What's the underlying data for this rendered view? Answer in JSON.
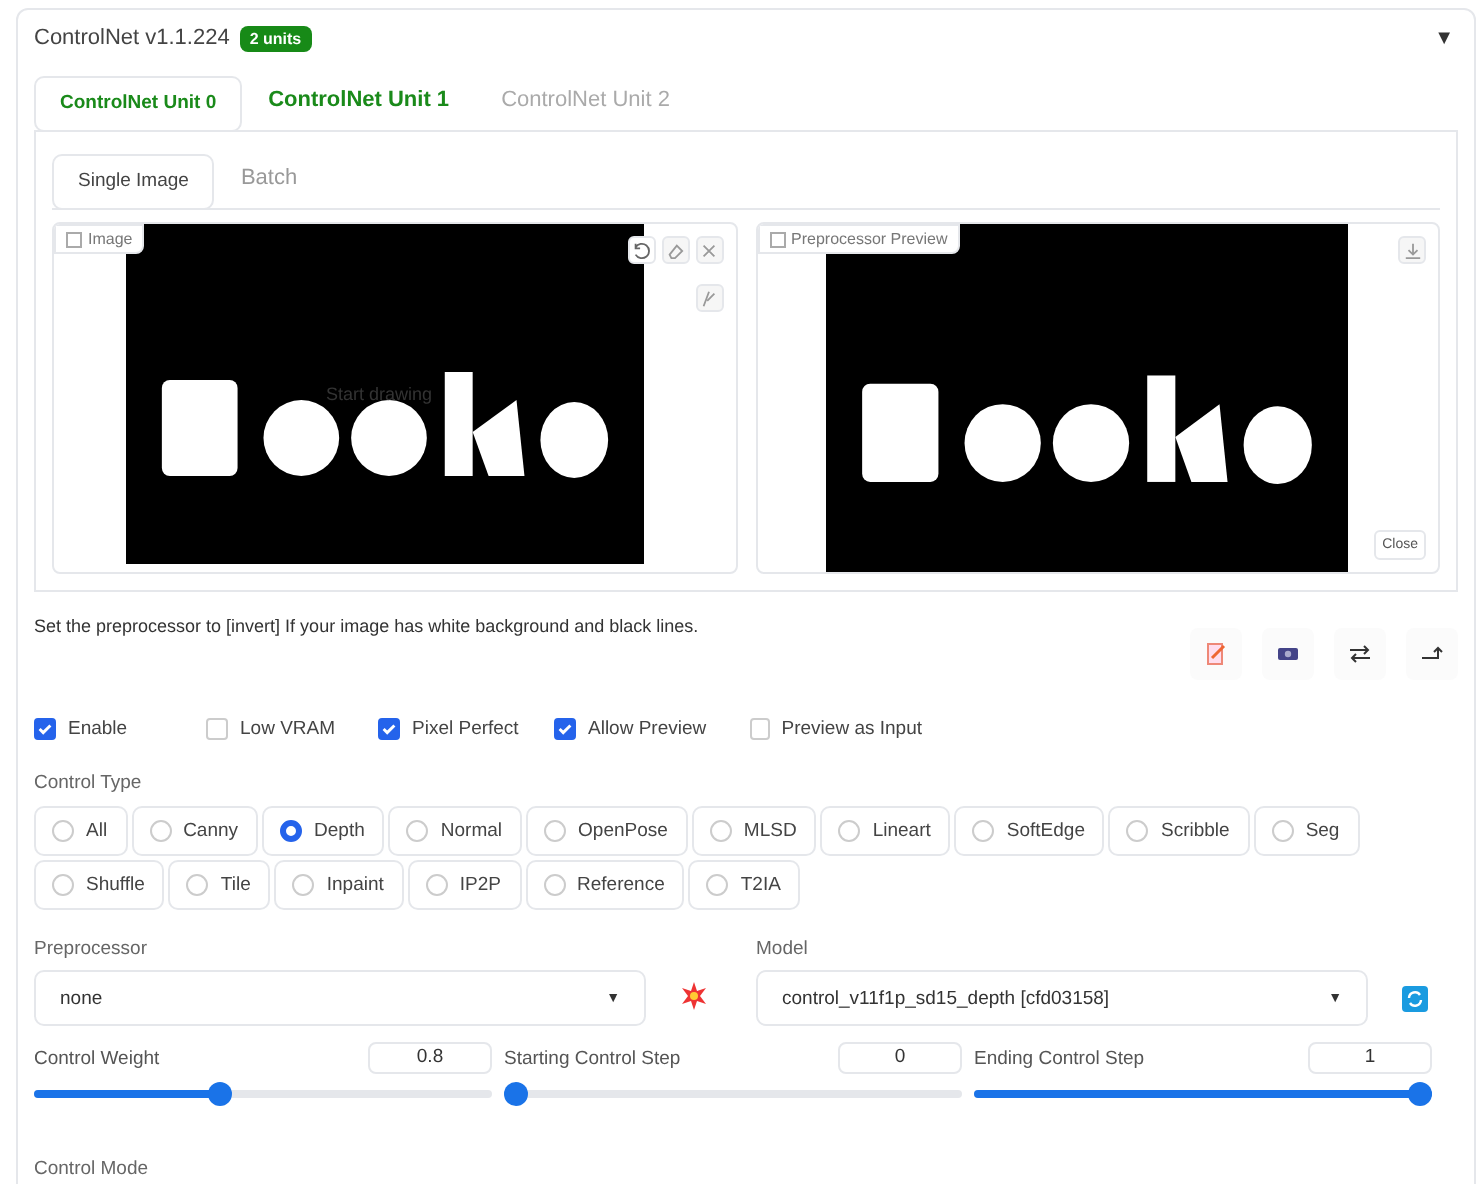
{
  "header": {
    "title": "ControlNet v1.1.224",
    "badge": "2 units",
    "toggle": "▼"
  },
  "unit_tabs": [
    {
      "label": "ControlNet Unit 0",
      "selected": true,
      "active": true
    },
    {
      "label": "ControlNet Unit 1",
      "selected": false,
      "active": true
    },
    {
      "label": "ControlNet Unit 2",
      "selected": false,
      "active": false
    }
  ],
  "image_tabs": [
    {
      "label": "Single Image",
      "selected": true
    },
    {
      "label": "Batch",
      "selected": false
    }
  ],
  "image_panel": {
    "label": "Image",
    "overlay": "Start drawing"
  },
  "preview_panel": {
    "label": "Preprocessor Preview",
    "close": "Close"
  },
  "hint": "Set the preprocessor to [invert] If your image has white background and black lines.",
  "options": [
    {
      "label": "Enable",
      "checked": true
    },
    {
      "label": "Low VRAM",
      "checked": false
    },
    {
      "label": "Pixel Perfect",
      "checked": true
    },
    {
      "label": "Allow Preview",
      "checked": true
    },
    {
      "label": "Preview as Input",
      "checked": false
    }
  ],
  "control_type": {
    "label": "Control Type",
    "choices": [
      {
        "label": "All",
        "selected": false
      },
      {
        "label": "Canny",
        "selected": false
      },
      {
        "label": "Depth",
        "selected": true
      },
      {
        "label": "Normal",
        "selected": false
      },
      {
        "label": "OpenPose",
        "selected": false
      },
      {
        "label": "MLSD",
        "selected": false
      },
      {
        "label": "Lineart",
        "selected": false
      },
      {
        "label": "SoftEdge",
        "selected": false
      },
      {
        "label": "Scribble",
        "selected": false
      },
      {
        "label": "Seg",
        "selected": false
      },
      {
        "label": "Shuffle",
        "selected": false
      },
      {
        "label": "Tile",
        "selected": false
      },
      {
        "label": "Inpaint",
        "selected": false
      },
      {
        "label": "IP2P",
        "selected": false
      },
      {
        "label": "Reference",
        "selected": false
      },
      {
        "label": "T2IA",
        "selected": false
      }
    ]
  },
  "preprocessor": {
    "label": "Preprocessor",
    "value": "none",
    "caret": "▼"
  },
  "model": {
    "label": "Model",
    "value": "control_v11f1p_sd15_depth [cfd03158]",
    "caret": "▼"
  },
  "sliders": [
    {
      "label": "Control Weight",
      "value": "0.8",
      "level": 0.4
    },
    {
      "label": "Starting Control Step",
      "value": "0",
      "level": 0
    },
    {
      "label": "Ending Control Step",
      "value": "1",
      "level": 1
    }
  ],
  "control_mode": {
    "label": "Control Mode"
  }
}
